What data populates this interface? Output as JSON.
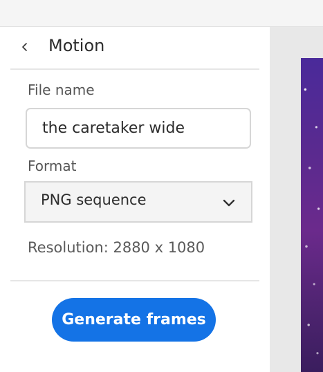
{
  "header": {
    "title": "Motion",
    "back_icon": "chevron-left-icon"
  },
  "file_name": {
    "label": "File name",
    "value": "the caretaker wide"
  },
  "format": {
    "label": "Format",
    "selected": "PNG sequence",
    "chevron_icon": "chevron-down-icon"
  },
  "resolution_text": "Resolution: 2880 x 1080",
  "actions": {
    "generate_label": "Generate frames"
  },
  "colors": {
    "accent": "#1473e6",
    "preview_purple": "#5a2a8f"
  }
}
